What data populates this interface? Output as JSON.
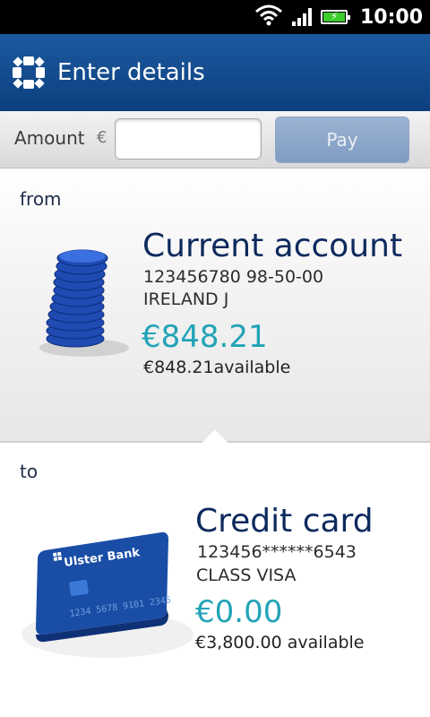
{
  "status_bar": {
    "time": "10:00",
    "icons": [
      "wifi-icon",
      "signal-icon",
      "battery-charging-icon"
    ]
  },
  "header": {
    "logo_icon": "bank-logo-icon",
    "title": "Enter details",
    "color_top": "#1c5aa0",
    "color_bottom": "#0d3f7e"
  },
  "amount": {
    "label": "Amount",
    "currency": "€",
    "value": "",
    "pay_label": "Pay"
  },
  "from": {
    "label": "from",
    "icon": "coins-stack-icon",
    "account_name": "Current account",
    "account_details": "123456780   98-50-00",
    "account_holder": "IRELAND J",
    "balance": "€848.21",
    "available": "€848.21available"
  },
  "to": {
    "label": "to",
    "icon": "credit-card-icon",
    "card_bank_text": "Ulster Bank",
    "card_number_text": "1234 5678 9101 2345",
    "account_name": "Credit card",
    "account_details": "123456******6543",
    "account_holder": "CLASS VISA",
    "balance": "€0.00",
    "available": "€3,800.00 available"
  },
  "colors": {
    "accent_teal": "#22a3b7",
    "title_navy": "#0d2a5e"
  }
}
